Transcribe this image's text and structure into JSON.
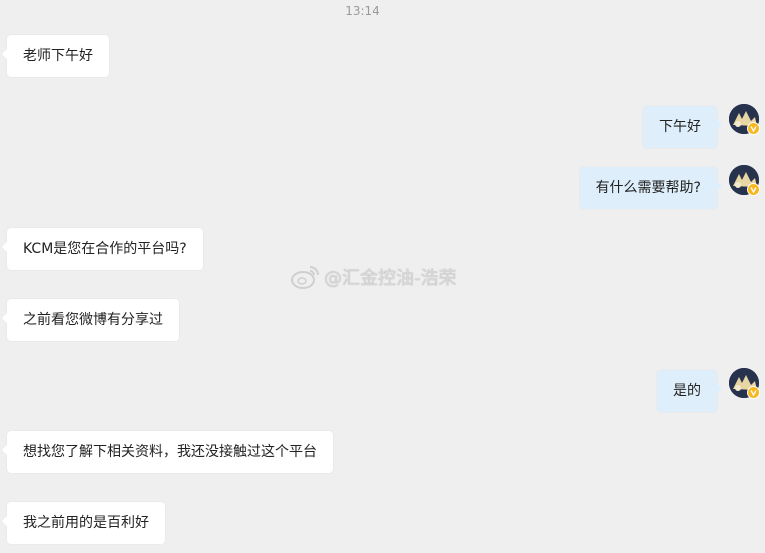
{
  "timestamp": "13:14",
  "watermark": {
    "text": "@汇金控油-浩荣",
    "icon": "weibo-logo-icon"
  },
  "messages": [
    {
      "side": "left",
      "text": "老师下午好"
    },
    {
      "side": "right",
      "text": "下午好"
    },
    {
      "side": "right",
      "text": "有什么需要帮助?"
    },
    {
      "side": "left",
      "text": "KCM是您在合作的平台吗?"
    },
    {
      "side": "left",
      "text": "之前看您微博有分享过"
    },
    {
      "side": "right",
      "text": "是的"
    },
    {
      "side": "left",
      "text": "想找您了解下相关资料，我还没接触过这个平台"
    },
    {
      "side": "left",
      "text": "我之前用的是百利好"
    }
  ],
  "colors": {
    "background": "#efefef",
    "left_bubble": "#ffffff",
    "right_bubble": "#deeffb",
    "verified_badge": "#f6b81f"
  }
}
